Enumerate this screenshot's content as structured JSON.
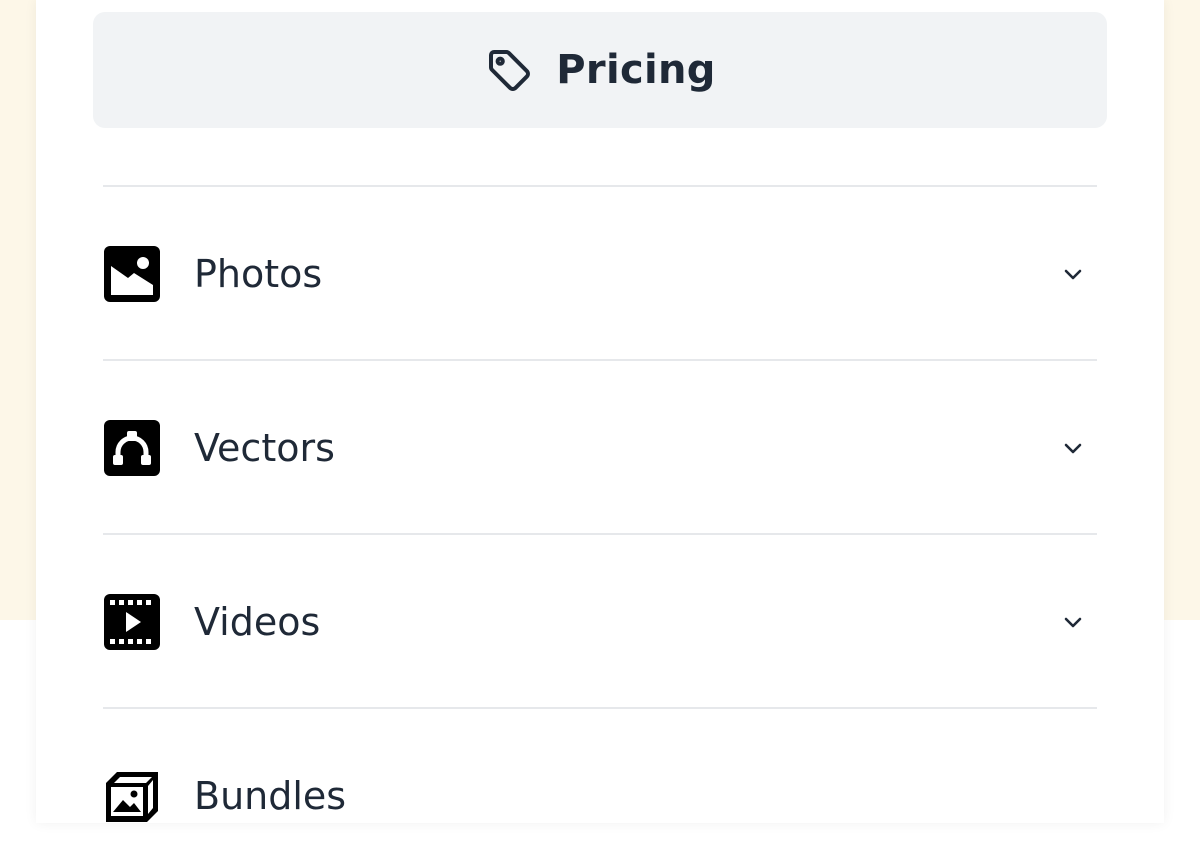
{
  "pricing": {
    "label": "Pricing",
    "icon": "tag-icon"
  },
  "menu": {
    "items": [
      {
        "label": "Photos",
        "icon": "photo-icon",
        "expandable": true
      },
      {
        "label": "Vectors",
        "icon": "vector-icon",
        "expandable": true
      },
      {
        "label": "Videos",
        "icon": "video-icon",
        "expandable": true
      },
      {
        "label": "Bundles",
        "icon": "bundle-icon",
        "expandable": false
      }
    ]
  },
  "colors": {
    "text": "#1f2937",
    "button_bg": "#f1f3f5",
    "divider": "#e6e8eb",
    "cream_bg": "#fdf7e8"
  }
}
